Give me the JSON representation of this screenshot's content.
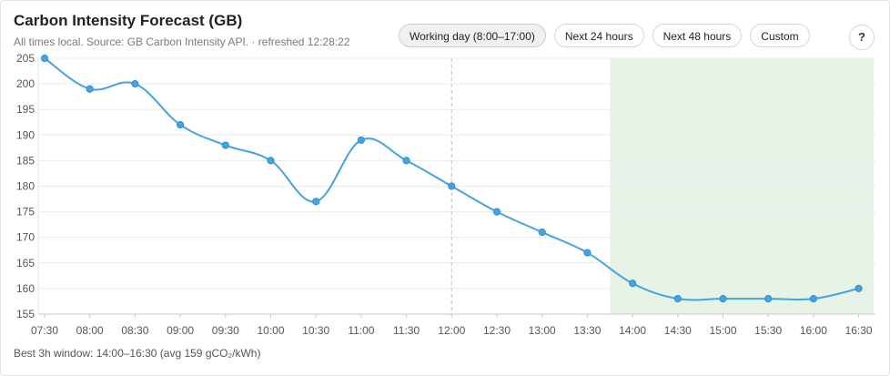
{
  "header": {
    "title": "Carbon Intensity Forecast (GB)",
    "subtitle": "All times local. Source: GB Carbon Intensity API. · refreshed 12:28:22"
  },
  "controls": {
    "buttons": [
      "Working day (8:00–17:00)",
      "Next 24 hours",
      "Next 48 hours",
      "Custom"
    ],
    "active_index": 0,
    "help_label": "?"
  },
  "footer": {
    "best_window": "Best 3h window: 14:00–16:30 (avg 159 gCO₂/kWh)"
  },
  "chart_data": {
    "type": "line",
    "categories": [
      "07:30",
      "08:00",
      "08:30",
      "09:00",
      "09:30",
      "10:00",
      "10:30",
      "11:00",
      "11:30",
      "12:00",
      "12:30",
      "13:00",
      "13:30",
      "14:00",
      "14:30",
      "15:00",
      "15:30",
      "16:00",
      "16:30"
    ],
    "values": [
      205,
      199,
      200,
      192,
      188,
      185,
      177,
      189,
      185,
      180,
      175,
      171,
      167,
      161,
      158,
      158,
      158,
      158,
      160
    ],
    "yticks": [
      155,
      160,
      165,
      170,
      175,
      180,
      185,
      190,
      195,
      200,
      205
    ],
    "ylim": [
      155,
      205
    ],
    "now_marker": "12:00",
    "highlight_window": {
      "from": "13:45",
      "to": "16:40"
    },
    "grid": true,
    "colors": {
      "line": "#45a3e0",
      "highlight": "#e8f3e8",
      "grid": "#ececec",
      "now": "#c8c8c8"
    }
  }
}
